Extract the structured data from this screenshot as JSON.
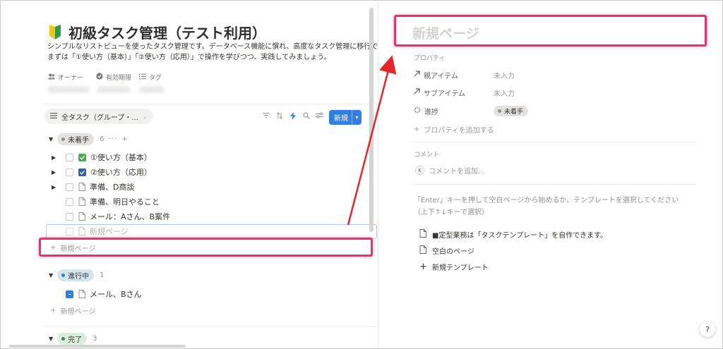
{
  "database": {
    "title": "初級タスク管理（テスト利用）",
    "description_line1": "シンプルなリストビューを使ったタスク管理です。データベース機能に慣れ、高度なタスク管理に移行でき",
    "description_line2": "まずは「①使い方（基本）」「②使い方（応用）」で操作を学びつつ、実践してみましょう。",
    "meta": {
      "owner": "オーナー",
      "deadline": "有効期限",
      "tag": "タグ"
    }
  },
  "view": {
    "tab_label": "全タスク（グループ・...",
    "new_button": "新規"
  },
  "groups": [
    {
      "label": "未着手",
      "count": "6",
      "color": "#e3e2e0",
      "dot": "#91918e",
      "items": [
        {
          "title": "①使い方（基本）"
        },
        {
          "title": "②使い方（応用）"
        },
        {
          "title": "準備、D商談"
        },
        {
          "title": "準備、明日やること"
        },
        {
          "title": "メール：Aさん、B案件"
        }
      ],
      "editing_placeholder": "新規ページ",
      "add_label": "新規ページ"
    },
    {
      "label": "進行中",
      "count": "1",
      "color": "#d3e5ef",
      "dot": "#2f7ee6",
      "items": [
        {
          "title": "メール、Bさん"
        }
      ],
      "add_label": "新規ページ"
    },
    {
      "label": "完了",
      "count": "3",
      "color": "#dbeddb",
      "dot": "#448361"
    }
  ],
  "page": {
    "title_placeholder": "新規ページ",
    "properties_heading": "プロパティ",
    "properties": [
      {
        "name": "親アイテム",
        "value": "未入力"
      },
      {
        "name": "サブアイテム",
        "value": "未入力"
      },
      {
        "name": "進捗",
        "value": "未着手"
      }
    ],
    "add_property": "プロパティを追加する",
    "comments_heading": "コメント",
    "comment_placeholder": "コメントを追加...",
    "comment_avatar": "K",
    "hint": "「Enter」キーを押して空白ページから始めるか、テンプレートを選択してください（上下↑↓キーで選択）",
    "templates": [
      {
        "label": "■定型業務は「タスクテンプレート」を自作できます。"
      },
      {
        "label": "空白のページ"
      },
      {
        "label": "新規テンプレート"
      }
    ],
    "help": "?"
  },
  "colors": {
    "highlight": "#e8326d",
    "accent": "#2f7ee6",
    "checkbox_green": "#4dab53"
  }
}
